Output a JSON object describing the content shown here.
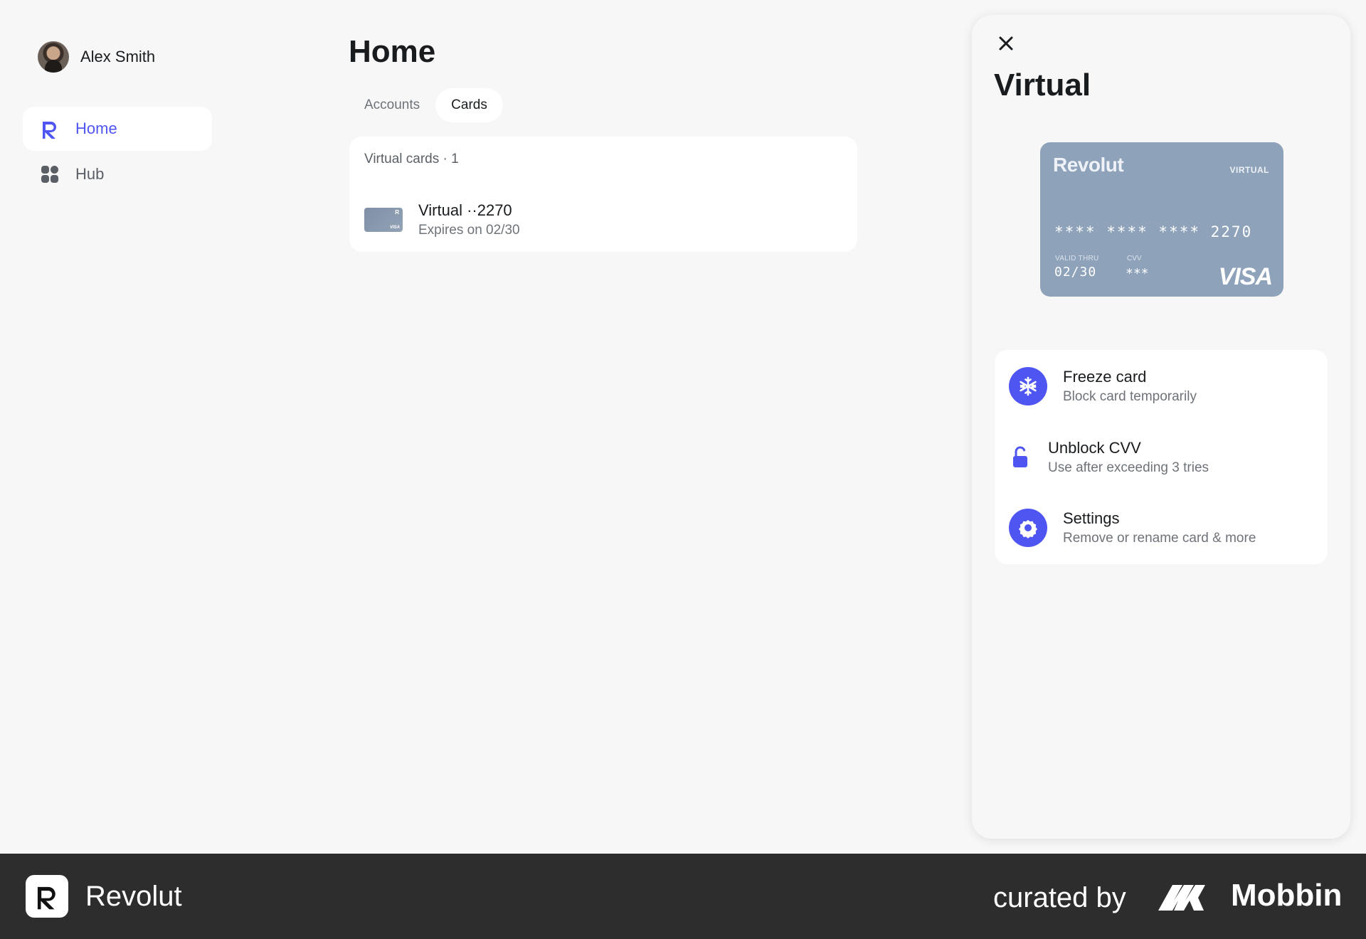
{
  "sidebar": {
    "user_name": "Alex Smith",
    "items": [
      {
        "label": "Home",
        "icon": "revolut-r-icon",
        "active": true
      },
      {
        "label": "Hub",
        "icon": "grid-icon",
        "active": false
      }
    ]
  },
  "main": {
    "title": "Home",
    "tabs": [
      {
        "label": "Accounts",
        "active": false
      },
      {
        "label": "Cards",
        "active": true
      }
    ],
    "section_label": "Virtual cards · 1",
    "card": {
      "title": "Virtual ··2270",
      "subtitle": "Expires on 02/30",
      "thumb_brand": "R",
      "thumb_network": "VISA"
    }
  },
  "drawer": {
    "title": "Virtual",
    "card": {
      "brand": "Revolut",
      "tag": "VIRTUAL",
      "number": "**** **** **** 2270",
      "valid_label": "VALID THRU",
      "valid": "02/30",
      "cvv_label": "CVV",
      "cvv": "***",
      "network": "VISA",
      "color": "#8ea2ba"
    },
    "actions": [
      {
        "title": "Freeze card",
        "subtitle": "Block card temporarily",
        "icon": "snowflake-icon"
      },
      {
        "title": "Unblock CVV",
        "subtitle": "Use after exceeding 3 tries",
        "icon": "unlock-icon"
      },
      {
        "title": "Settings",
        "subtitle": "Remove or rename card & more",
        "icon": "gear-icon"
      }
    ]
  },
  "footer": {
    "brand": "Revolut",
    "curated": "curated by",
    "mobbin": "Mobbin"
  },
  "colors": {
    "accent": "#4f55f1",
    "background": "#f7f7f7",
    "footer": "#2d2d2d"
  }
}
